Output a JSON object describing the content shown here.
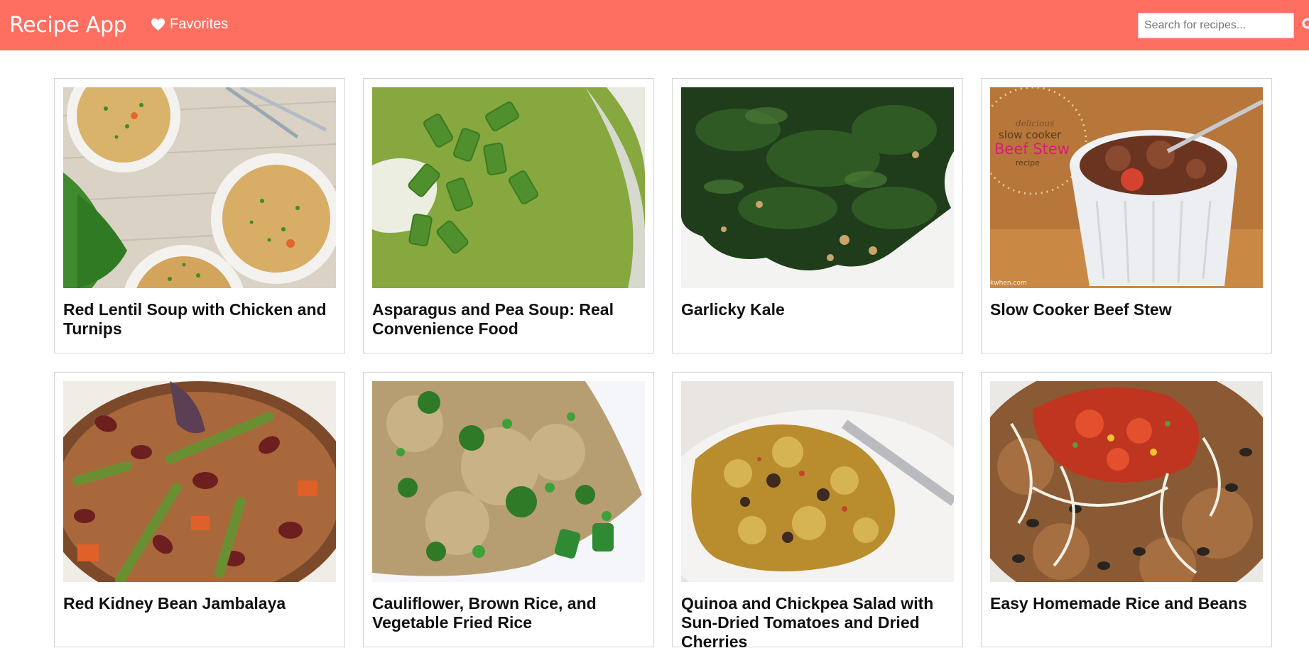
{
  "header": {
    "brand": "Recipe App",
    "favorites_label": "Favorites",
    "search_placeholder": "Search for recipes...",
    "bar_color": "#ff6f61"
  },
  "recipes": [
    {
      "title": "Red Lentil Soup with Chicken and Turnips"
    },
    {
      "title": "Asparagus and Pea Soup: Real Convenience Food"
    },
    {
      "title": "Garlicky Kale"
    },
    {
      "title": "Slow Cooker Beef Stew",
      "image_caption": "delicious slow cooker Beef Stew recipe",
      "watermark": "kwhen.com"
    },
    {
      "title": "Red Kidney Bean Jambalaya"
    },
    {
      "title": "Cauliflower, Brown Rice, and Vegetable Fried Rice"
    },
    {
      "title": "Quinoa and Chickpea Salad with Sun-Dried Tomatoes and Dried Cherries"
    },
    {
      "title": "Easy Homemade Rice and Beans"
    }
  ]
}
